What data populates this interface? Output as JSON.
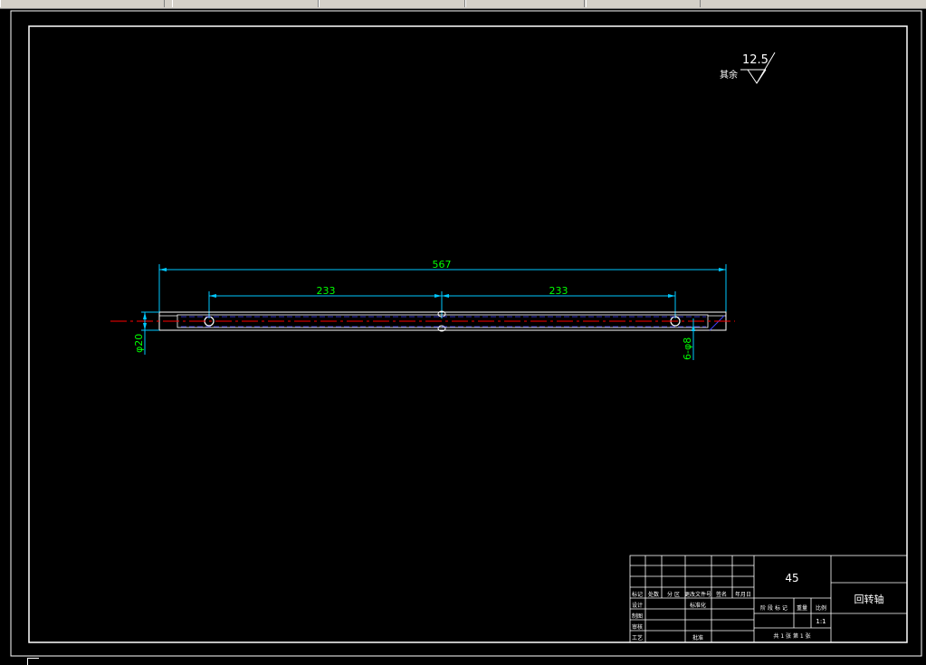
{
  "drawing": {
    "roughness_note": "其余",
    "roughness_value": "12.5",
    "dimensions": {
      "overall_length": "567",
      "left_span": "233",
      "right_span": "233",
      "diameter": "φ20",
      "holes": "6-φ8"
    }
  },
  "title_block": {
    "material": "45",
    "part_name": "回转轴",
    "scale": "1:1",
    "header_labels": [
      "标记",
      "处数",
      "分 区",
      "更改文件号",
      "签名",
      "年月日"
    ],
    "row_labels": [
      "设计",
      "审核",
      "工艺"
    ],
    "standardization": "标准化",
    "approval": "批准",
    "extra_row": "制图",
    "stage_labels": [
      "阶 段 标 记",
      "重量",
      "比例"
    ],
    "sheet_info": "共 1 张  第 1 张"
  },
  "colors": {
    "border": "#ffffff",
    "dimension": "#00c8ff",
    "dimension_text": "#00ff00",
    "centerline": "#ff0000",
    "hidden": "#4040ff",
    "part": "#ffffff"
  }
}
